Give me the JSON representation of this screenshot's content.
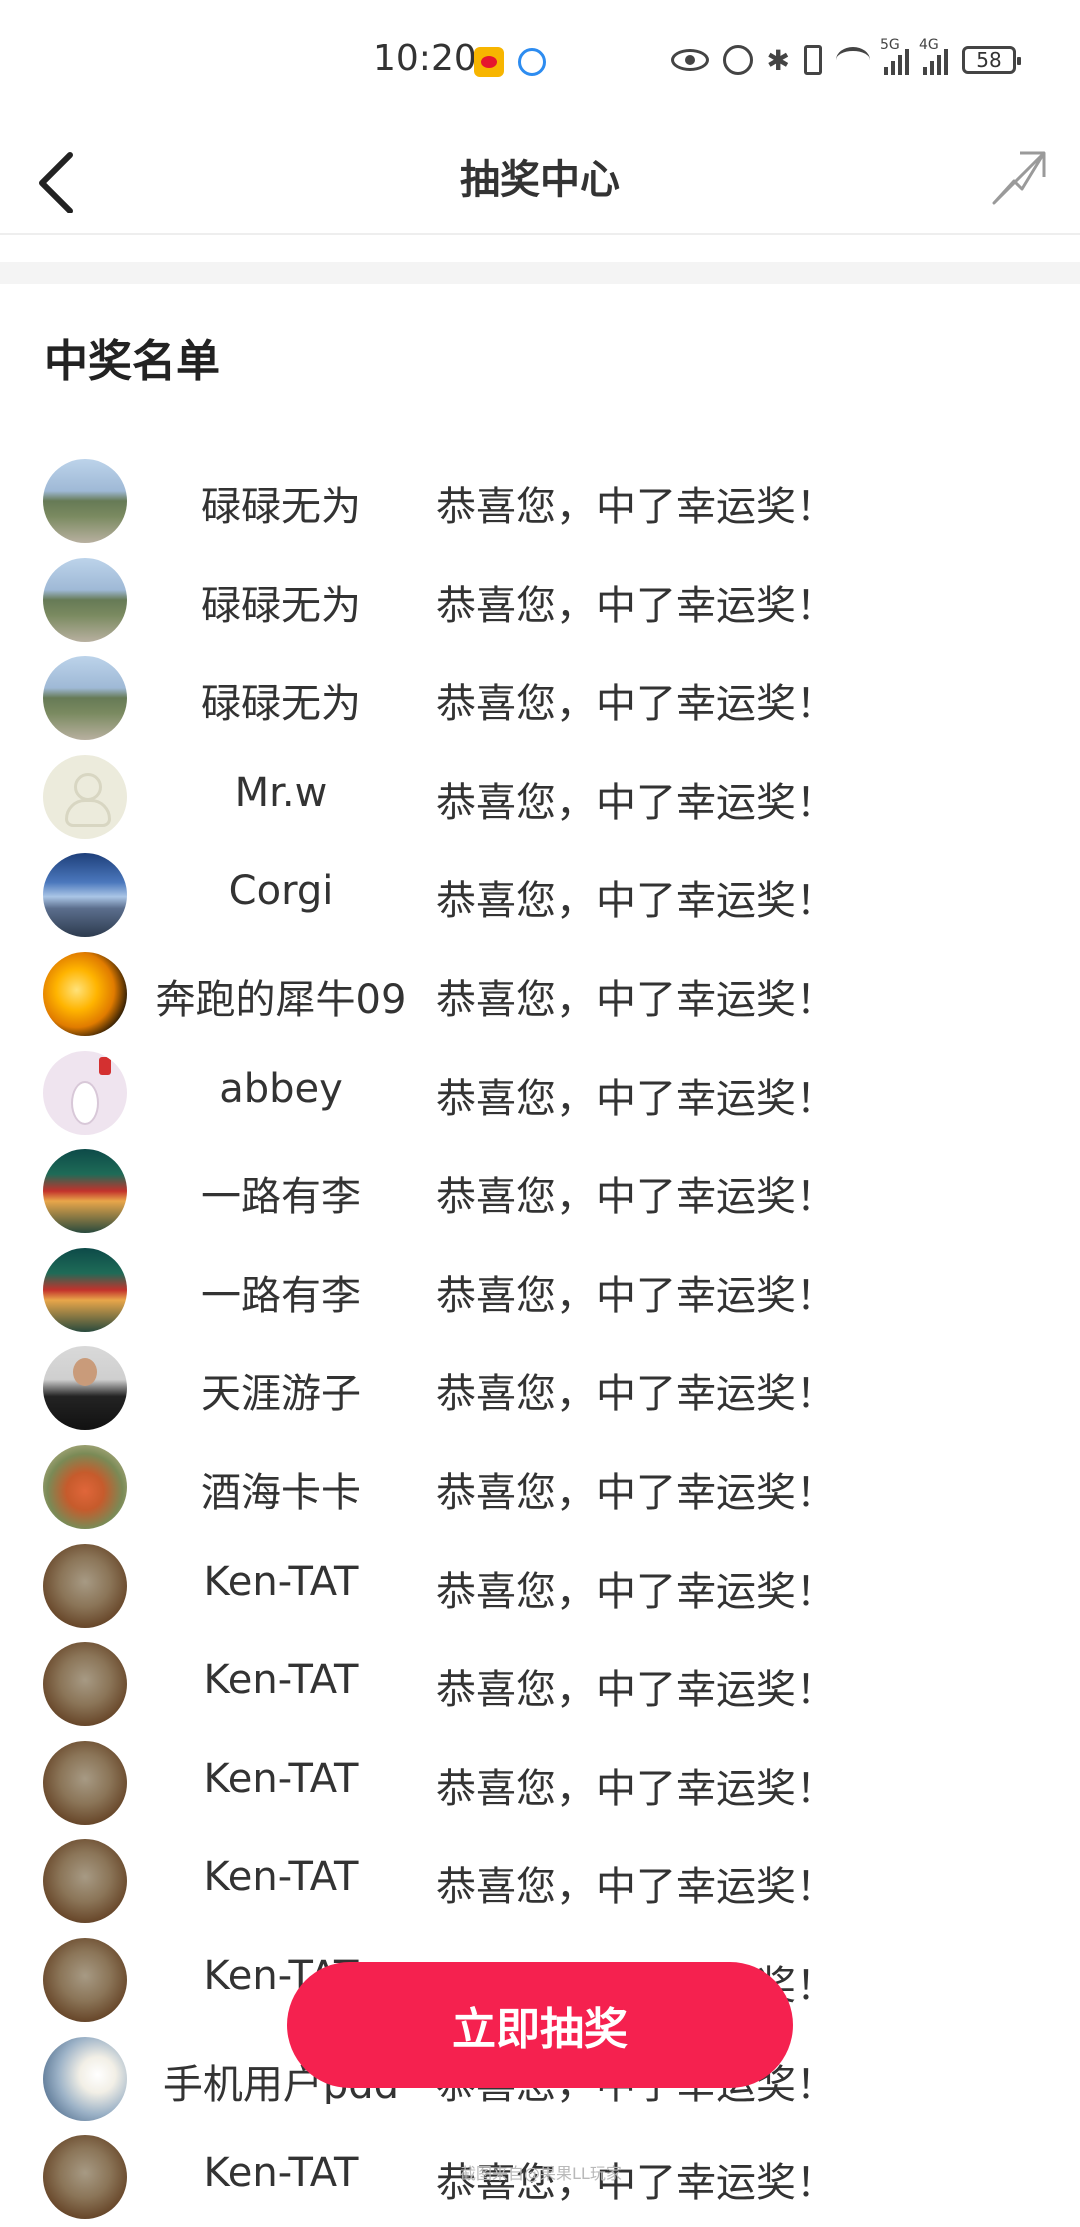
{
  "status_bar": {
    "time": "10:20",
    "signal_1_tag": "5G",
    "signal_2_tag": "4G",
    "battery": "58"
  },
  "nav": {
    "title": "抽奖中心"
  },
  "section": {
    "title": "中奖名单"
  },
  "winners": [
    {
      "name": "碌碌无为",
      "message": "恭喜您，中了幸运奖！",
      "avatar": "landscape"
    },
    {
      "name": "碌碌无为",
      "message": "恭喜您，中了幸运奖！",
      "avatar": "landscape"
    },
    {
      "name": "碌碌无为",
      "message": "恭喜您，中了幸运奖！",
      "avatar": "landscape"
    },
    {
      "name": "Mr.w",
      "message": "恭喜您，中了幸运奖！",
      "avatar": "default"
    },
    {
      "name": "Corgi",
      "message": "恭喜您，中了幸运奖！",
      "avatar": "sky"
    },
    {
      "name": "奔跑的犀牛09",
      "message": "恭喜您，中了幸运奖！",
      "avatar": "sunset"
    },
    {
      "name": "abbey",
      "message": "恭喜您，中了幸运奖！",
      "avatar": "bunny"
    },
    {
      "name": "一路有李",
      "message": "恭喜您，中了幸运奖！",
      "avatar": "train"
    },
    {
      "name": "一路有李",
      "message": "恭喜您，中了幸运奖！",
      "avatar": "train"
    },
    {
      "name": "天涯游子",
      "message": "恭喜您，中了幸运奖！",
      "avatar": "man"
    },
    {
      "name": "酒海卡卡",
      "message": "恭喜您，中了幸运奖！",
      "avatar": "food"
    },
    {
      "name": "Ken-TAT",
      "message": "恭喜您，中了幸运奖！",
      "avatar": "cat"
    },
    {
      "name": "Ken-TAT",
      "message": "恭喜您，中了幸运奖！",
      "avatar": "cat"
    },
    {
      "name": "Ken-TAT",
      "message": "恭喜您，中了幸运奖！",
      "avatar": "cat"
    },
    {
      "name": "Ken-TAT",
      "message": "恭喜您，中了幸运奖！",
      "avatar": "cat"
    },
    {
      "name": "Ken-TAT",
      "message": "恭喜您，中了幸运奖！",
      "avatar": "cat"
    },
    {
      "name": "手机用户pdd",
      "message": "恭喜您，中了幸运奖！",
      "avatar": "light"
    },
    {
      "name": "Ken-TAT",
      "message": "恭喜您，中了幸运奖！",
      "avatar": "cat"
    }
  ],
  "draw_button": {
    "label": "立即抽奖"
  },
  "watermark": "截图来自@果果LL玩家",
  "colors": {
    "accent": "#f5214f",
    "background": "#ffffff",
    "divider": "#f4f4f4"
  }
}
